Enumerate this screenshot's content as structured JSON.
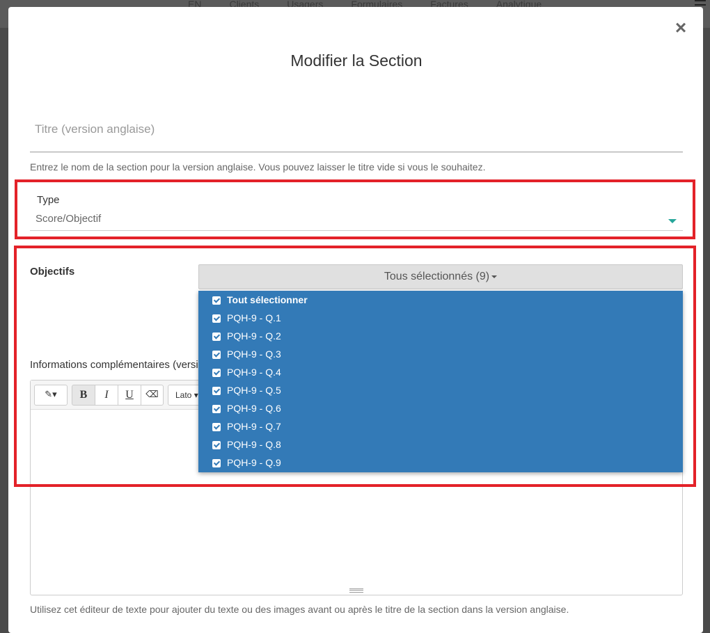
{
  "background_nav": {
    "items": [
      "EN",
      "Clients",
      "Usagers",
      "Formulaires",
      "Factures",
      "Analytique"
    ]
  },
  "modal": {
    "title": "Modifier la Section",
    "close_icon": "×",
    "title_field": {
      "placeholder": "Titre (version anglaise)",
      "value": "",
      "help": "Entrez le nom de la section pour la version anglaise. Vous pouvez laisser le titre vide si vous le souhaitez."
    },
    "type": {
      "label": "Type",
      "value": "Score/Objectif"
    },
    "objectives": {
      "label": "Objectifs",
      "button_label": "Tous sélectionnés (9)",
      "options": [
        {
          "label": "Tout sélectionner",
          "checked": true
        },
        {
          "label": "PQH-9 - Q.1",
          "checked": true
        },
        {
          "label": "PQH-9 - Q.2",
          "checked": true
        },
        {
          "label": "PQH-9 - Q.3",
          "checked": true
        },
        {
          "label": "PQH-9 - Q.4",
          "checked": true
        },
        {
          "label": "PQH-9 - Q.5",
          "checked": true
        },
        {
          "label": "PQH-9 - Q.6",
          "checked": true
        },
        {
          "label": "PQH-9 - Q.7",
          "checked": true
        },
        {
          "label": "PQH-9 - Q.8",
          "checked": true
        },
        {
          "label": "PQH-9 - Q.9",
          "checked": true
        }
      ]
    },
    "info": {
      "label": "Informations complémentaires (version anglaise)",
      "help": "Utilisez cet éditeur de texte pour ajouter du texte ou des images avant ou après le titre de la section dans la version anglaise."
    },
    "editor_toolbar": {
      "magic": "magic-wand-icon",
      "bold": "B",
      "italic": "I",
      "underline": "U",
      "eraser": "eraser-icon",
      "font": "Lato"
    }
  },
  "colors": {
    "highlight": "#e32229",
    "dropdown_bg": "#337ab7",
    "select_caret": "#26a69a"
  }
}
